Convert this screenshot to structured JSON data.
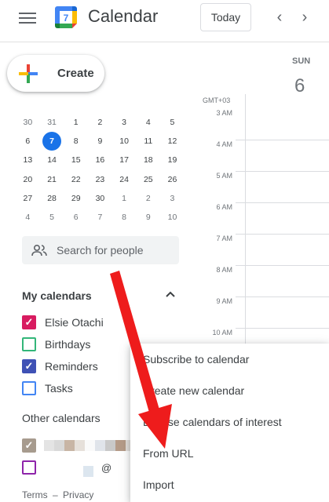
{
  "header": {
    "title": "Calendar",
    "logo_day": "7",
    "today_label": "Today",
    "prev_icon": "‹",
    "next_icon": "›"
  },
  "create": {
    "label": "Create"
  },
  "day_header": {
    "day_name": "SUN",
    "day_number": "6"
  },
  "mini_calendar": {
    "weeks": [
      [
        {
          "d": "30"
        },
        {
          "d": "31"
        },
        {
          "d": "1"
        },
        {
          "d": "2"
        },
        {
          "d": "3"
        },
        {
          "d": "4"
        },
        {
          "d": "5"
        }
      ],
      [
        {
          "d": "6"
        },
        {
          "d": "7",
          "today": true
        },
        {
          "d": "8"
        },
        {
          "d": "9"
        },
        {
          "d": "10"
        },
        {
          "d": "11"
        },
        {
          "d": "12"
        }
      ],
      [
        {
          "d": "13"
        },
        {
          "d": "14"
        },
        {
          "d": "15"
        },
        {
          "d": "16"
        },
        {
          "d": "17"
        },
        {
          "d": "18"
        },
        {
          "d": "19"
        }
      ],
      [
        {
          "d": "20"
        },
        {
          "d": "21"
        },
        {
          "d": "22"
        },
        {
          "d": "23"
        },
        {
          "d": "24"
        },
        {
          "d": "25"
        },
        {
          "d": "26"
        }
      ],
      [
        {
          "d": "27"
        },
        {
          "d": "28"
        },
        {
          "d": "29"
        },
        {
          "d": "30"
        },
        {
          "d": "1"
        },
        {
          "d": "2"
        },
        {
          "d": "3"
        }
      ],
      [
        {
          "d": "4"
        },
        {
          "d": "5"
        },
        {
          "d": "6"
        },
        {
          "d": "7"
        },
        {
          "d": "8"
        },
        {
          "d": "9"
        },
        {
          "d": "10"
        }
      ]
    ]
  },
  "search_people": {
    "placeholder": "Search for people"
  },
  "my_calendars": {
    "title": "My calendars",
    "items": [
      {
        "label": "Elsie Otachi",
        "color": "#d81b60",
        "checked": true
      },
      {
        "label": "Birthdays",
        "color": "#33b679",
        "checked": false
      },
      {
        "label": "Reminders",
        "color": "#3f51b5",
        "checked": true
      },
      {
        "label": "Tasks",
        "color": "#4285f4",
        "checked": false
      }
    ]
  },
  "other_calendars": {
    "title": "Other calendars",
    "items": [
      {
        "color": "#a79b8e",
        "checked": true
      },
      {
        "color": "#8e24aa",
        "checked": false,
        "suffix": "@"
      }
    ]
  },
  "footer": {
    "terms": "Terms",
    "separator": "–",
    "privacy": "Privacy"
  },
  "time_grid": {
    "timezone": "GMT+03",
    "labels": [
      "3 AM",
      "4 AM",
      "5 AM",
      "6 AM",
      "7 AM",
      "8 AM",
      "9 AM",
      "10 AM"
    ]
  },
  "context_menu": {
    "items": [
      "Subscribe to calendar",
      "Create new calendar",
      "Browse calendars of interest",
      "From URL",
      "Import"
    ]
  },
  "colors": {
    "accent": "#1a73e8",
    "annotation_arrow": "#ee1c1c"
  }
}
